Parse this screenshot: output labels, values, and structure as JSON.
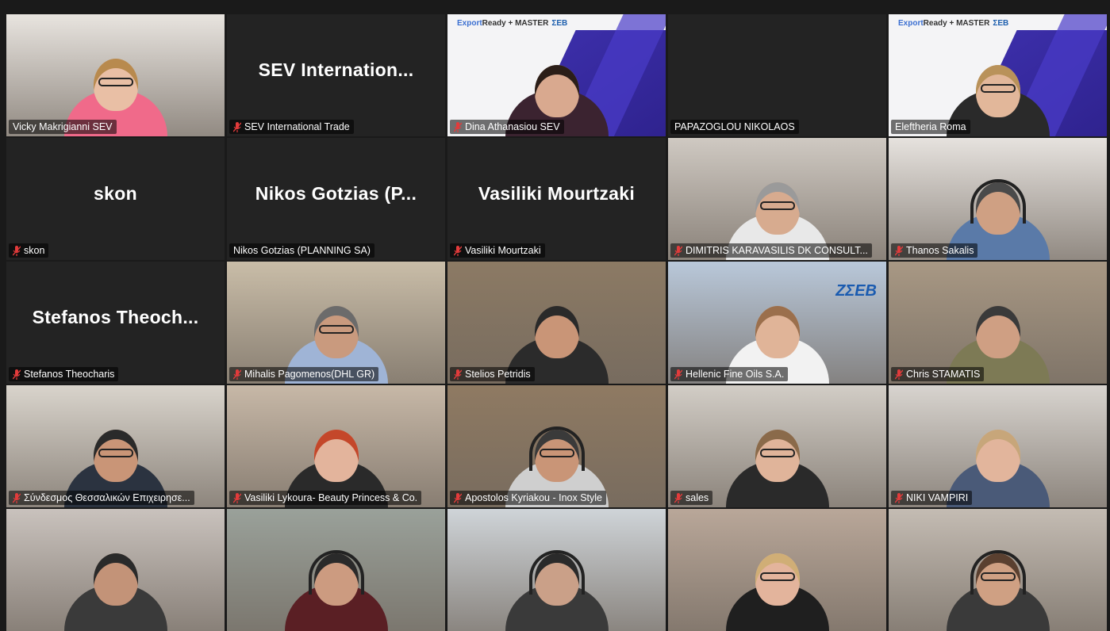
{
  "participants": [
    {
      "label": "Vicky Makrigianni SEV",
      "big": "",
      "mic_muted": false,
      "speaking": false,
      "bg": "#e8e4df",
      "skin": "#e9bfa5",
      "hair": "#b88a4e",
      "shirt": "#f06a8a",
      "glasses": true
    },
    {
      "label": "SEV International Trade",
      "big": "SEV  Internation...",
      "mic_muted": true
    },
    {
      "label": "Dina Athanasiou SEV",
      "big": "",
      "mic_muted": true,
      "brand": true,
      "skin": "#d9a98f",
      "hair": "#2b1e18",
      "shirt": "#3b2330"
    },
    {
      "label": "PAPAZOGLOU NIKOLAOS",
      "big": "",
      "mic_muted": false
    },
    {
      "label": "Eleftheria Roma",
      "big": "",
      "mic_muted": false,
      "speaking": true,
      "brand": true,
      "skin": "#e2b79a",
      "hair": "#b9925a",
      "shirt": "#2a2a2a",
      "glasses": true
    },
    {
      "label": "skon",
      "big": "skon",
      "mic_muted": true
    },
    {
      "label": "Nikos Gotzias (PLANNING SA)",
      "big": "Nikos Gotzias (P...",
      "mic_muted": false
    },
    {
      "label": "Vasiliki Mourtzaki",
      "big": "Vasiliki Mourtzaki",
      "mic_muted": true
    },
    {
      "label": "DIMITRIS KARAVASILIS DK CONSULT...",
      "big": "",
      "mic_muted": true,
      "bg": "#cfc9c2",
      "skin": "#d7ab8f",
      "hair": "#9a9a9a",
      "shirt": "#e8e8e8",
      "glasses": true
    },
    {
      "label": "Thanos Sakalis",
      "big": "",
      "mic_muted": true,
      "bg": "#e6e2de",
      "skin": "#cfa083",
      "hair": "#4a4a4a",
      "shirt": "#5a7aa8",
      "headset": true
    },
    {
      "label": "Stefanos Theocharis",
      "big": "Stefanos  Theoch...",
      "mic_muted": true
    },
    {
      "label": "Mihalis Pagomenos(DHL GR)",
      "big": "",
      "mic_muted": true,
      "bg": "#c9bda8",
      "skin": "#c99a7e",
      "hair": "#6b6b6b",
      "shirt": "#9fb4d6",
      "glasses": true
    },
    {
      "label": "Stelios Petridis",
      "big": "",
      "mic_muted": true,
      "bg": "#8c7a64",
      "skin": "#c99577",
      "hair": "#2a2a2a",
      "shirt": "#2b2b2b"
    },
    {
      "label": "Hellenic Fine Oils S.A.",
      "big": "",
      "mic_muted": true,
      "bg": "#b9c8da",
      "skin": "#e0b498",
      "hair": "#9b6f4c",
      "shirt": "#f2f2f2",
      "sev": "ΖΣΕΒ"
    },
    {
      "label": "Chris STAMATIS",
      "big": "",
      "mic_muted": true,
      "bg": "#a89884",
      "skin": "#cf9f83",
      "hair": "#3a3a3a",
      "shirt": "#7d7a55"
    },
    {
      "label": "Σύνδεσμος Θεσσαλικών Επιχειρησε...",
      "big": "",
      "mic_muted": true,
      "bg": "#d9d4cc",
      "skin": "#c99577",
      "hair": "#2a2a2a",
      "shirt": "#2b3340",
      "glasses": true
    },
    {
      "label": "Vasiliki Lykoura- Beauty Princess & Co.",
      "big": "",
      "mic_muted": true,
      "bg": "#c7b8a7",
      "skin": "#e3b49c",
      "hair": "#c4472a",
      "shirt": "#2a2a2a"
    },
    {
      "label": "Apostolos Kyriakou - Inox Style",
      "big": "",
      "mic_muted": true,
      "bg": "#8f7a62",
      "skin": "#c99577",
      "hair": "#3a3a3a",
      "shirt": "#cfcfcf",
      "headset": true,
      "glasses": true
    },
    {
      "label": "sales",
      "big": "",
      "mic_muted": true,
      "bg": "#d2cdc6",
      "skin": "#e0b49a",
      "hair": "#8a6a4a",
      "shirt": "#2a2a2a",
      "glasses": true
    },
    {
      "label": "NIKI VAMPIRI",
      "big": "",
      "mic_muted": true,
      "bg": "#d8d4cf",
      "skin": "#e2b59c",
      "hair": "#c7a67a",
      "shirt": "#4a5a78"
    },
    {
      "label": "",
      "big": "",
      "mic_muted": false,
      "bg": "#c9c2bd",
      "skin": "#c39378",
      "hair": "#2a2a2a",
      "shirt": "#3a3a3a"
    },
    {
      "label": "",
      "big": "",
      "mic_muted": false,
      "bg": "#9aa19a",
      "skin": "#cc9b80",
      "hair": "#2a2a2a",
      "shirt": "#5a1f24",
      "headset": true
    },
    {
      "label": "",
      "big": "",
      "mic_muted": false,
      "bg": "#cfd4d8",
      "skin": "#caa088",
      "hair": "#2a2a2a",
      "shirt": "#3a3a3a",
      "headset": true
    },
    {
      "label": "",
      "big": "",
      "mic_muted": false,
      "bg": "#b9a799",
      "skin": "#e3b49c",
      "hair": "#d0ae76",
      "shirt": "#1f1f1f",
      "glasses": true
    },
    {
      "label": "",
      "big": "",
      "mic_muted": false,
      "bg": "#c4bcb3",
      "skin": "#cfa083",
      "hair": "#5a4030",
      "shirt": "#3a3a3a",
      "headset": true,
      "glasses": true
    }
  ],
  "brand_overlay": {
    "export": "Export",
    "ready": "Ready",
    "master": "+ MASTER",
    "sev": "ΣΕΒ"
  }
}
